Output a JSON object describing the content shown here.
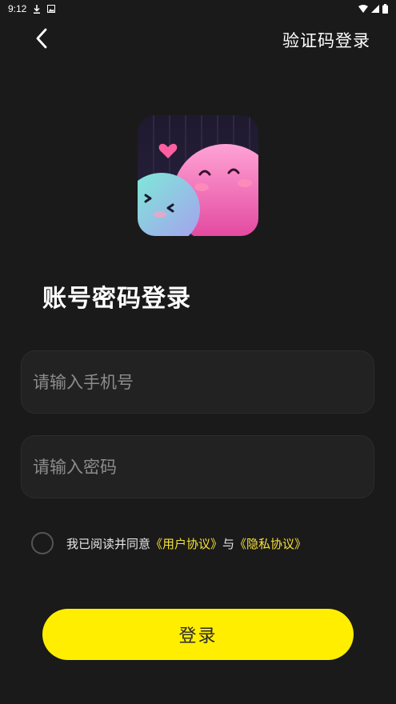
{
  "status_bar": {
    "time": "9:12",
    "icons": [
      "download-icon",
      "photo-icon",
      "wifi-icon",
      "signal-icon",
      "battery-icon"
    ]
  },
  "header": {
    "back_icon": "chevron-left-icon",
    "switch_login_label": "验证码登录"
  },
  "logo": {
    "icon": "app-logo-icon"
  },
  "title": "账号密码登录",
  "form": {
    "phone_placeholder": "请输入手机号",
    "phone_value": "",
    "password_placeholder": "请输入密码",
    "password_value": ""
  },
  "agreement": {
    "checked": false,
    "prefix": "我已阅读并同意",
    "user_agreement": "《用户协议》",
    "connector": "与",
    "privacy_policy": "《隐私协议》"
  },
  "login_button_label": "登录",
  "colors": {
    "background": "#1a1a1a",
    "accent": "#ffee00",
    "link": "#f5e23a",
    "field_bg": "#222222"
  }
}
